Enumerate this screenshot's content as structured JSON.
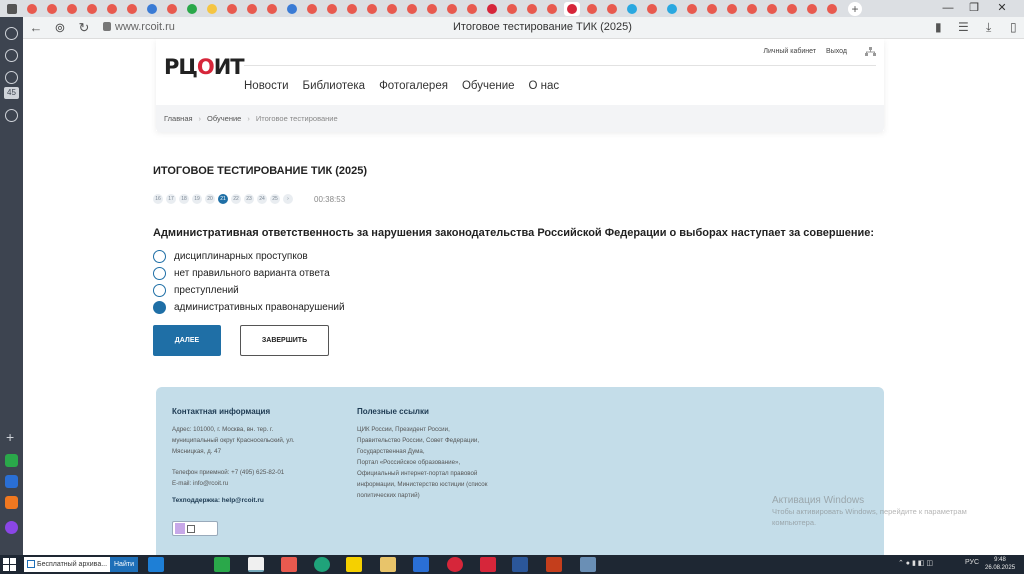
{
  "browser": {
    "url": "www.rcoit.ru",
    "tab_title": "Итоговое тестирование ТИК (2025)",
    "side_badge": "45",
    "tab_colors": [
      "#e85a4f",
      "#e85a4f",
      "#e85a4f",
      "#e85a4f",
      "#e85a4f",
      "#e85a4f",
      "#3a7bd5",
      "#e85a4f",
      "#2aa84a",
      "#f5c542",
      "#e85a4f",
      "#e85a4f",
      "#e85a4f",
      "#3a7bd5",
      "#e85a4f",
      "#e85a4f",
      "#e85a4f",
      "#e85a4f",
      "#e85a4f",
      "#e85a4f",
      "#e85a4f",
      "#e85a4f",
      "#e85a4f",
      "#d6263a",
      "#e85a4f",
      "#e85a4f",
      "#e85a4f",
      "#d6263a",
      "#e85a4f",
      "#e85a4f",
      "#2aa8e0",
      "#e85a4f",
      "#2aa8e0",
      "#e85a4f",
      "#e85a4f",
      "#e85a4f",
      "#e85a4f",
      "#e85a4f",
      "#e85a4f",
      "#e85a4f",
      "#e85a4f"
    ]
  },
  "site": {
    "logo": {
      "part1": "РЦ",
      "check": "О",
      "part2": "ИТ"
    },
    "top_links": [
      "Личный кабинет",
      "Выход"
    ],
    "nav": [
      "Новости",
      "Библиотека",
      "Фотогалерея",
      "Обучение",
      "О нас"
    ],
    "breadcrumb": [
      "Главная",
      "Обучение",
      "Итоговое тестирование"
    ]
  },
  "test": {
    "title": "ИТОГОВОЕ ТЕСТИРОВАНИЕ ТИК (2025)",
    "question_numbers": [
      "16",
      "17",
      "18",
      "19",
      "20",
      "21",
      "22",
      "23",
      "24",
      "25",
      "›"
    ],
    "active_number": "21",
    "timer": "00:38:53",
    "question": "Административная ответственность за нарушения законодательства Российской Федерации о выборах наступает за совершение:",
    "options": [
      {
        "label": "дисциплинарных проступков",
        "checked": false
      },
      {
        "label": "нет правильного варианта ответа",
        "checked": false
      },
      {
        "label": "преступлений",
        "checked": false
      },
      {
        "label": "административных правонарушений",
        "checked": true
      }
    ],
    "next_label": "ДАЛЕЕ",
    "finish_label": "ЗАВЕРШИТЬ"
  },
  "footer": {
    "contact_title": "Контактная информация",
    "address_lines": [
      "Адрес: 101000, г. Москва, вн. тер. г.",
      "муниципальный округ Красносельский, ул.",
      "Мясницкая, д. 47"
    ],
    "phone": "Телефон приемной: +7 (495) 625-82-01",
    "email": "E-mail: info@rcoit.ru",
    "support": "Техподдержка: help@rcoit.ru",
    "links_title": "Полезные ссылки",
    "links_lines": [
      "ЦИК России, Президент России,",
      "Правительство России, Совет Федерации,",
      "Государственная Дума,",
      "Портал «Российское образование»,",
      "Официальный интернет-портал правовой",
      "информации, Министерство юстиции (список",
      "политических партий)"
    ]
  },
  "windows_activation": {
    "title": "Активация Windows",
    "text": "Чтобы активировать Windows, перейдите к параметрам компьютера."
  },
  "taskbar": {
    "search_text": "Бесплатный архива...",
    "search_button": "Найти",
    "lang": "РУС",
    "time": "9:48",
    "date": "26.08.2025"
  }
}
